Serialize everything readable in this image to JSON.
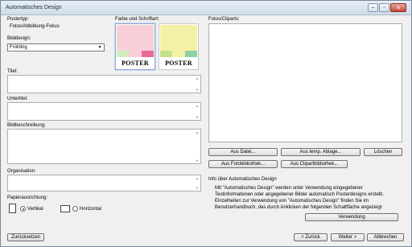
{
  "window": {
    "title": "Automatisches Design"
  },
  "fields": {
    "postertyp_label": "Postertyp:",
    "postertyp_value": "Fotos/Abbildung-Fokus",
    "bilddesign_label": "Bilddesign:",
    "bilddesign_value": "Frühling",
    "farbe_label": "Farbe und Schriftart:",
    "fotos_label": "Fotos/Cliparts:",
    "titel_label": "Titel:",
    "untertitel_label": "Untertitel:",
    "bildbeschreibung_label": "Bildbeschreibung:",
    "organisation_label": "Organisation:",
    "papier_label": "Papierausrichtung:",
    "vertikal_label": "Vertikal",
    "horizontal_label": "Horizontal",
    "orientation_selected": "Vertikal"
  },
  "designs": [
    {
      "caption": "POSTER",
      "top_color": "#f9cfd8",
      "strip": [
        "#d2ecc1",
        "#f9cfd8",
        "#e86b9a"
      ],
      "selected": true
    },
    {
      "caption": "POSTER",
      "top_color": "#f3f1a6",
      "strip": [
        "#c6e08a",
        "#f3f1a6",
        "#8fd1a7"
      ],
      "selected": false
    }
  ],
  "buttons": {
    "aus_datei": "Aus Datei...",
    "aus_temp_ablage": "Aus temp. Ablage...",
    "loeschen": "Löschen",
    "aus_fotobibliothek": "Aus Fotobibliothek...",
    "aus_clipartbibliothek": "Aus Clipartbibliothek...",
    "verwendung": "Verwendung",
    "zuruecksetzen": "Zurücksetzen",
    "zurueck": "< Zurück",
    "weiter": "Weiter >",
    "abbrechen": "Abbrechen"
  },
  "info": {
    "heading": "Info über Automatisches Design",
    "lines": [
      "Mit \"Automatisches Design\" werden unter Verwendung eingegebener",
      "Textinformationen oder angegebener Bilder automatisch Posterdesigns erstellt.",
      "Einzelheiten zur Verwendung von \"Automatisches Design\" finden Sie im",
      "Benutzerhandbuch, das durch Anklicken der folgenden Schaltfläche angezeigt"
    ]
  },
  "icons": {
    "dropdown": "chevron-down-icon",
    "scroll_up": "scroll-up-icon",
    "scroll_down": "scroll-down-icon",
    "portrait": "portrait-page-icon",
    "landscape": "landscape-page-icon"
  }
}
